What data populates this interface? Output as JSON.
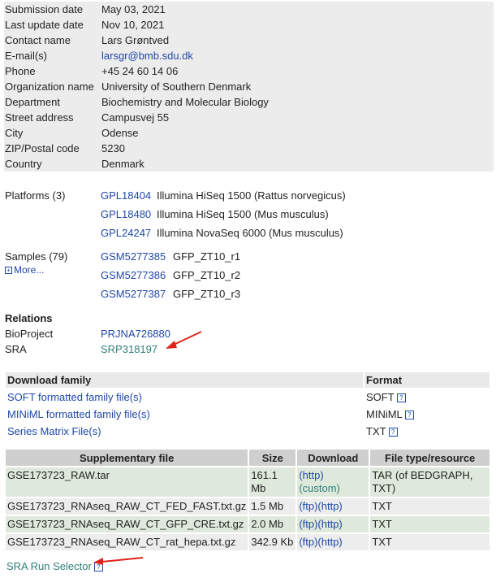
{
  "info": [
    {
      "key": "Submission date",
      "value": "May 03, 2021"
    },
    {
      "key": "Last update date",
      "value": "Nov 10, 2021"
    },
    {
      "key": "Contact name",
      "value": "Lars Grøntved"
    },
    {
      "key": "E-mail(s)",
      "value": "larsgr@bmb.sdu.dk",
      "link": true
    },
    {
      "key": "Phone",
      "value": "+45 24 60 14 06"
    },
    {
      "key": "Organization name",
      "value": "University of Southern Denmark"
    },
    {
      "key": "Department",
      "value": "Biochemistry and Molecular Biology"
    },
    {
      "key": "Street address",
      "value": "Campusvej 55"
    },
    {
      "key": "City",
      "value": "Odense"
    },
    {
      "key": "ZIP/Postal code",
      "value": "5230"
    },
    {
      "key": "Country",
      "value": "Denmark"
    }
  ],
  "platforms": {
    "label": "Platforms (3)",
    "items": [
      {
        "acc": "GPL18404",
        "desc": "Illumina HiSeq 1500 (Rattus norvegicus)"
      },
      {
        "acc": "GPL18480",
        "desc": "Illumina HiSeq 1500 (Mus musculus)"
      },
      {
        "acc": "GPL24247",
        "desc": "Illumina NovaSeq 6000 (Mus musculus)"
      }
    ]
  },
  "samples": {
    "label": "Samples (79)",
    "more": "More...",
    "items": [
      {
        "acc": "GSM5277385",
        "desc": "GFP_ZT10_r1"
      },
      {
        "acc": "GSM5277386",
        "desc": "GFP_ZT10_r2"
      },
      {
        "acc": "GSM5277387",
        "desc": "GFP_ZT10_r3"
      }
    ]
  },
  "relations": {
    "title": "Relations",
    "bioproject_label": "BioProject",
    "bioproject": "PRJNA726880",
    "sra_label": "SRA",
    "sra": "SRP318197"
  },
  "download_family": {
    "col1": "Download family",
    "col2": "Format",
    "rows": [
      {
        "name": "SOFT formatted family file(s)",
        "format": "SOFT"
      },
      {
        "name": "MINiML formatted family file(s)",
        "format": "MINiML"
      },
      {
        "name": "Series Matrix File(s)",
        "format": "TXT"
      }
    ]
  },
  "supplementary": {
    "headers": [
      "Supplementary file",
      "Size",
      "Download",
      "File type/resource"
    ],
    "rows": [
      {
        "file": "GSE173723_RAW.tar",
        "size": "161.1 Mb",
        "dl1": "(http)",
        "dl2": "(custom)",
        "type": "TAR (of BEDGRAPH, TXT)"
      },
      {
        "file": "GSE173723_RNAseq_RAW_CT_FED_FAST.txt.gz",
        "size": "1.5 Mb",
        "dl1": "(ftp)(http)",
        "dl2": "",
        "type": "TXT"
      },
      {
        "file": "GSE173723_RNAseq_RAW_CT_GFP_CRE.txt.gz",
        "size": "2.0 Mb",
        "dl1": "(ftp)(http)",
        "dl2": "",
        "type": "TXT"
      },
      {
        "file": "GSE173723_RNAseq_RAW_CT_rat_hepa.txt.gz",
        "size": "342.9 Kb",
        "dl1": "(ftp)(http)",
        "dl2": "",
        "type": "TXT"
      }
    ]
  },
  "sra_run_selector": "SRA Run Selector",
  "help_glyph": "?",
  "plus_glyph": "+",
  "colors": {
    "link": "#2048a8",
    "teal_link": "#2f7f7a",
    "arrow": "#e0221b",
    "info_bg": "#ececec",
    "green_row": "#dfe9db"
  }
}
